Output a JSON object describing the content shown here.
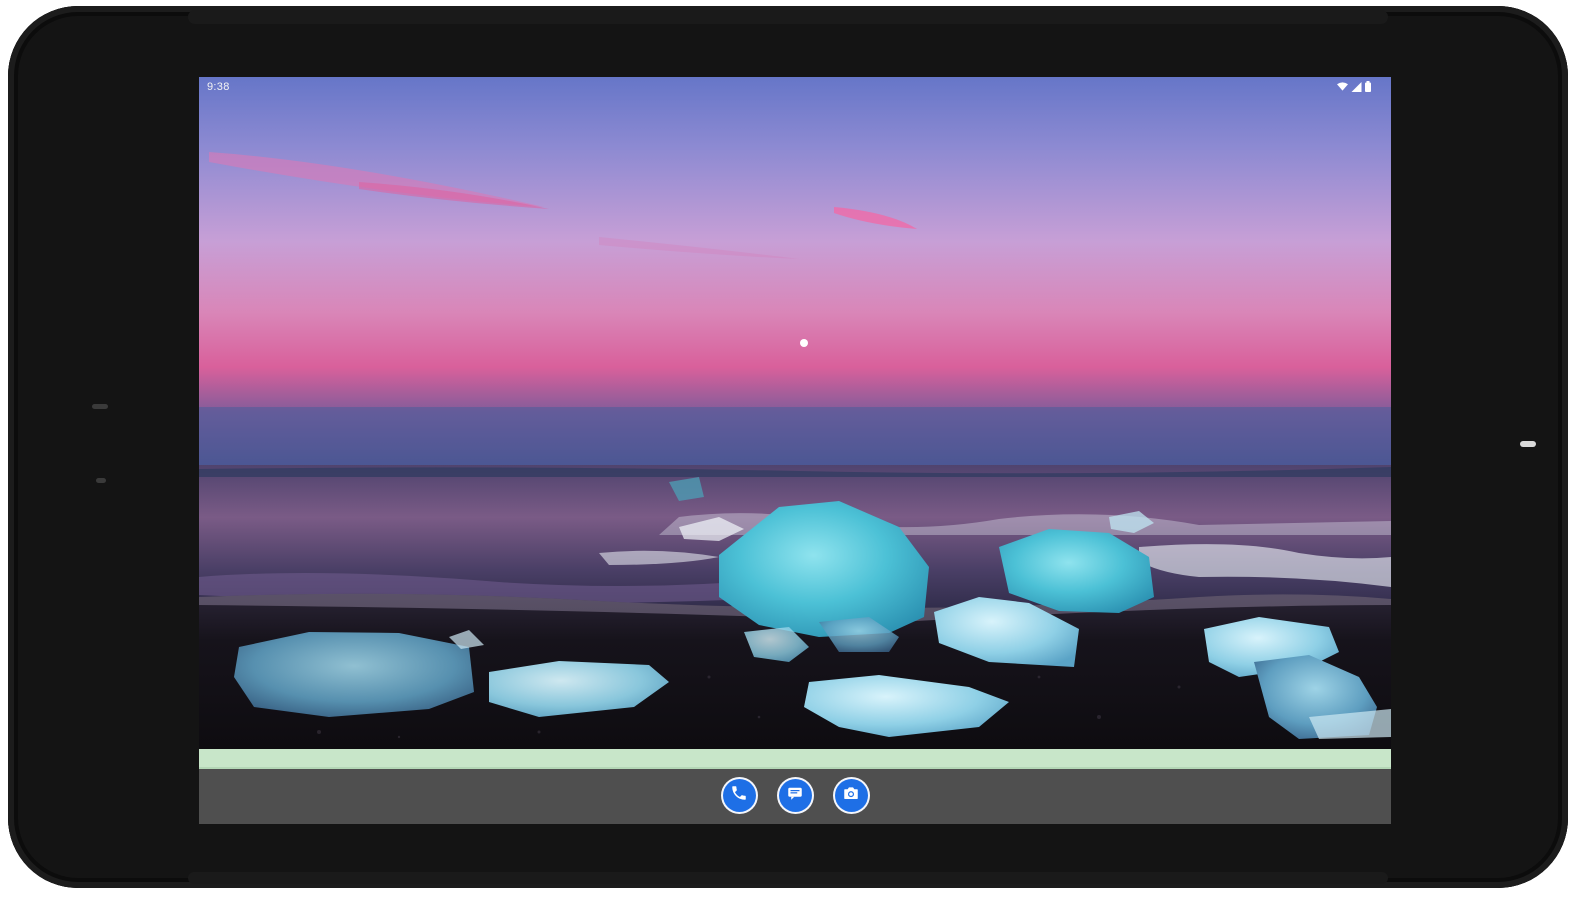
{
  "status_bar": {
    "time": "9:38",
    "icons": [
      "wifi-icon",
      "cell-signal-icon",
      "battery-icon"
    ]
  },
  "wallpaper": {
    "description_colors": {
      "sky_top": "#6f7fcf",
      "sky_mid": "#c69bd6",
      "horizon": "#d96aa0",
      "sea": "#3a3356",
      "sand": "#151318",
      "ice": "#5ec6d8"
    }
  },
  "dock": {
    "apps": [
      {
        "name": "phone",
        "icon": "phone-icon"
      },
      {
        "name": "messages",
        "icon": "message-icon"
      },
      {
        "name": "camera",
        "icon": "camera-icon"
      }
    ],
    "accent": "#1e6fe6",
    "strip_color": "#c8e6c9",
    "background": "#4f4f4f"
  }
}
